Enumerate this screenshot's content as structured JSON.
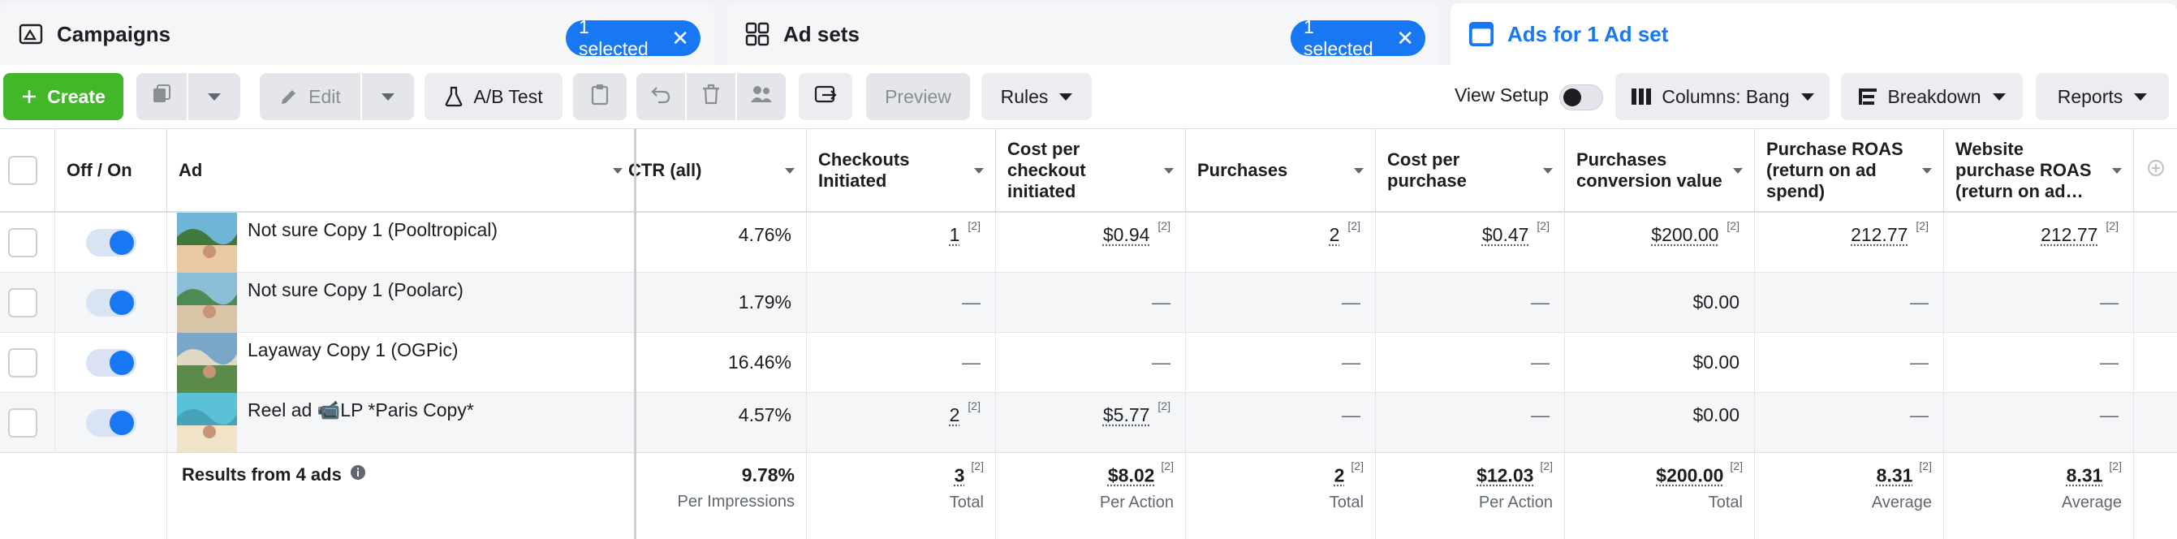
{
  "tabs": {
    "campaigns": {
      "label": "Campaigns",
      "pill": "1 selected"
    },
    "adsets": {
      "label": "Ad sets",
      "pill": "1 selected"
    },
    "ads": {
      "label": "Ads for 1 Ad set"
    }
  },
  "toolbar": {
    "create": "Create",
    "edit": "Edit",
    "ab_test": "A/B Test",
    "preview": "Preview",
    "rules": "Rules",
    "view_setup": "View Setup",
    "columns": "Columns: Bang",
    "breakdown": "Breakdown",
    "reports": "Reports"
  },
  "colors": {
    "accent": "#1877f2",
    "create_green": "#42b72a"
  },
  "table": {
    "headers": {
      "off_on": "Off / On",
      "ad": "Ad",
      "ctr": "CTR (all)",
      "checkouts": [
        "Checkouts",
        "Initiated"
      ],
      "cost_checkout": [
        "Cost per",
        "checkout",
        "initiated"
      ],
      "purchases": "Purchases",
      "cost_purchase": [
        "Cost per",
        "purchase"
      ],
      "conv_value": [
        "Purchases",
        "conversion value"
      ],
      "roas": [
        "Purchase ROAS",
        "(return on ad",
        "spend)"
      ],
      "web_roas": [
        "Website",
        "purchase ROAS",
        "(return on ad…"
      ]
    },
    "footnote": "[2]",
    "rows": [
      {
        "name": "Not sure Copy 1 (Pooltropical)",
        "ctr": "4.76%",
        "checkouts": "1",
        "cost_checkout": "$0.94",
        "purchases": "2",
        "cost_purchase": "$0.47",
        "conv_value": "$200.00",
        "roas": "212.77",
        "web_roas": "212.77"
      },
      {
        "name": "Not sure Copy 1 (Poolarc)",
        "ctr": "1.79%",
        "checkouts": "—",
        "cost_checkout": "—",
        "purchases": "—",
        "cost_purchase": "—",
        "conv_value": "$0.00",
        "roas": "—",
        "web_roas": "—"
      },
      {
        "name": "Layaway Copy 1 (OGPic)",
        "ctr": "16.46%",
        "checkouts": "—",
        "cost_checkout": "—",
        "purchases": "—",
        "cost_purchase": "—",
        "conv_value": "$0.00",
        "roas": "—",
        "web_roas": "—"
      },
      {
        "name": "Reel ad 📹LP *Paris Copy*",
        "ctr": "4.57%",
        "checkouts": "2",
        "cost_checkout": "$5.77",
        "purchases": "—",
        "cost_purchase": "—",
        "conv_value": "$0.00",
        "roas": "—",
        "web_roas": "—"
      }
    ],
    "totals": {
      "label": "Results from 4 ads",
      "ctr": {
        "value": "9.78%",
        "sub": "Per Impressions"
      },
      "checkouts": {
        "value": "3",
        "sub": "Total"
      },
      "cost_checkout": {
        "value": "$8.02",
        "sub": "Per Action"
      },
      "purchases": {
        "value": "2",
        "sub": "Total"
      },
      "cost_purchase": {
        "value": "$12.03",
        "sub": "Per Action"
      },
      "conv_value": {
        "value": "$200.00",
        "sub": "Total"
      },
      "roas": {
        "value": "8.31",
        "sub": "Average"
      },
      "web_roas": {
        "value": "8.31",
        "sub": "Average"
      }
    }
  }
}
